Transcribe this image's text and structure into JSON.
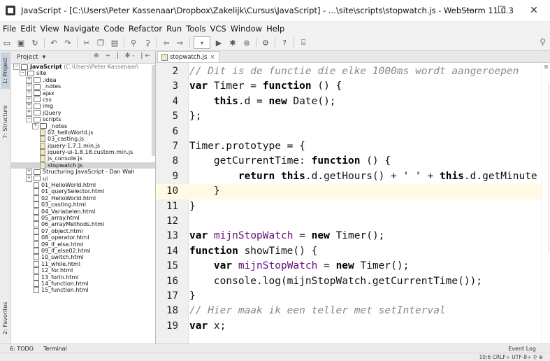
{
  "window": {
    "title": "JavaScript - [C:\\Users\\Peter Kassenaar\\Dropbox\\Zakelijk\\Cursus\\JavaScript] - ...\\site\\scripts\\stopwatch.js - WebStorm 11.0.3",
    "minimize": "—",
    "maximize": "☐",
    "close": "✕"
  },
  "menu": [
    "File",
    "Edit",
    "View",
    "Navigate",
    "Code",
    "Refactor",
    "Run",
    "Tools",
    "VCS",
    "Window",
    "Help"
  ],
  "toolbar_icons": [
    "folder-open-icon",
    "save-icon",
    "sync-icon",
    "undo-icon",
    "redo-icon",
    "cut-icon",
    "copy-icon",
    "paste-icon",
    "find-icon",
    "replace-icon",
    "back-icon",
    "forward-icon",
    "run-config-icon",
    "run-icon",
    "debug-icon",
    "coverage-icon",
    "vcs-icon",
    "help-icon",
    "terminal-icon"
  ],
  "left_tool_tabs": {
    "project": "1: Project",
    "structure": "7: Structure",
    "favorites": "2: Favorites"
  },
  "project_panel": {
    "header": "Project",
    "icons": "⊕ ÷ | ✻- |←",
    "tree": [
      {
        "indent": 0,
        "exp": "−",
        "icon": "folder",
        "label": "JavaScript",
        "bold": true,
        "suffix": " (C:\\Users\\Peter Kassenaar\\"
      },
      {
        "indent": 1,
        "exp": "−",
        "icon": "folder",
        "label": "site"
      },
      {
        "indent": 2,
        "exp": "+",
        "icon": "folder",
        "label": ".idea"
      },
      {
        "indent": 2,
        "exp": "+",
        "icon": "folder",
        "label": "_notes"
      },
      {
        "indent": 2,
        "exp": "+",
        "icon": "folder",
        "label": "ajax"
      },
      {
        "indent": 2,
        "exp": "+",
        "icon": "folder",
        "label": "css"
      },
      {
        "indent": 2,
        "exp": "+",
        "icon": "folder",
        "label": "img"
      },
      {
        "indent": 2,
        "exp": "+",
        "icon": "folder",
        "label": "jQuery"
      },
      {
        "indent": 2,
        "exp": "−",
        "icon": "folder",
        "label": "scripts"
      },
      {
        "indent": 3,
        "exp": "+",
        "icon": "folder",
        "label": "_notes"
      },
      {
        "indent": 3,
        "exp": "",
        "icon": "js",
        "label": "02_helloWorld.js"
      },
      {
        "indent": 3,
        "exp": "",
        "icon": "js",
        "label": "03_casting.js"
      },
      {
        "indent": 3,
        "exp": "",
        "icon": "js",
        "label": "jquery-1.7.1.min.js"
      },
      {
        "indent": 3,
        "exp": "",
        "icon": "js",
        "label": "jquery-ui-1.8.18.custom.min.js"
      },
      {
        "indent": 3,
        "exp": "",
        "icon": "js",
        "label": "js_console.js"
      },
      {
        "indent": 3,
        "exp": "",
        "icon": "js",
        "label": "stopwatch.js",
        "selected": true
      },
      {
        "indent": 2,
        "exp": "+",
        "icon": "folder",
        "label": "Structuring JavaScript - Dan Wah"
      },
      {
        "indent": 2,
        "exp": "+",
        "icon": "folder",
        "label": "ui"
      },
      {
        "indent": 2,
        "exp": "",
        "icon": "file",
        "label": "01_HelloWorld.html"
      },
      {
        "indent": 2,
        "exp": "",
        "icon": "file",
        "label": "01_querySelector.html"
      },
      {
        "indent": 2,
        "exp": "",
        "icon": "file",
        "label": "02_HelloWorld.html"
      },
      {
        "indent": 2,
        "exp": "",
        "icon": "file",
        "label": "03_casting.html"
      },
      {
        "indent": 2,
        "exp": "",
        "icon": "file",
        "label": "04_Variabelen.html"
      },
      {
        "indent": 2,
        "exp": "",
        "icon": "file",
        "label": "05_array.html"
      },
      {
        "indent": 2,
        "exp": "",
        "icon": "file",
        "label": "06_arrayMethods.html"
      },
      {
        "indent": 2,
        "exp": "",
        "icon": "file",
        "label": "07_object.html"
      },
      {
        "indent": 2,
        "exp": "",
        "icon": "file",
        "label": "08_operator.html"
      },
      {
        "indent": 2,
        "exp": "",
        "icon": "file",
        "label": "09_if_else.html"
      },
      {
        "indent": 2,
        "exp": "",
        "icon": "file",
        "label": "09_if_else02.html"
      },
      {
        "indent": 2,
        "exp": "",
        "icon": "file",
        "label": "10_switch.html"
      },
      {
        "indent": 2,
        "exp": "",
        "icon": "file",
        "label": "11_while.html"
      },
      {
        "indent": 2,
        "exp": "",
        "icon": "file",
        "label": "12_for.html"
      },
      {
        "indent": 2,
        "exp": "",
        "icon": "file",
        "label": "13_forIn.html"
      },
      {
        "indent": 2,
        "exp": "",
        "icon": "file",
        "label": "14_function.html"
      },
      {
        "indent": 2,
        "exp": "",
        "icon": "file",
        "label": "15_function.html"
      }
    ]
  },
  "editor": {
    "tab_label": "stopwatch.js",
    "tab_close": "×",
    "lines": [
      {
        "num": "2",
        "text": "// Dit is de functie die elke 1000ms wordt aangeroepen",
        "kind": "comment"
      },
      {
        "num": "3",
        "text": "var Timer = function () {",
        "kind": "code"
      },
      {
        "num": "4",
        "text": "    this.d = new Date();",
        "kind": "code"
      },
      {
        "num": "5",
        "text": "};",
        "kind": "code"
      },
      {
        "num": "6",
        "text": "",
        "kind": "code"
      },
      {
        "num": "7",
        "text": "Timer.prototype = {",
        "kind": "code"
      },
      {
        "num": "8",
        "text": "    getCurrentTime: function () {",
        "kind": "code"
      },
      {
        "num": "9",
        "text": "        return this.d.getHours() + ' ' + this.d.getMinute",
        "kind": "code"
      },
      {
        "num": "10",
        "text": "    }",
        "kind": "code",
        "caret": true
      },
      {
        "num": "11",
        "text": "}",
        "kind": "code"
      },
      {
        "num": "12",
        "text": "",
        "kind": "code"
      },
      {
        "num": "13",
        "text": "var mijnStopWatch = new Timer();",
        "kind": "code"
      },
      {
        "num": "14",
        "text": "function showTime() {",
        "kind": "code"
      },
      {
        "num": "15",
        "text": "    var mijnStopWatch = new Timer();",
        "kind": "code"
      },
      {
        "num": "16",
        "text": "    console.log(mijnStopWatch.getCurrentTime());",
        "kind": "code"
      },
      {
        "num": "17",
        "text": "}",
        "kind": "code"
      },
      {
        "num": "18",
        "text": "// Hier maak ik een teller met setInterval",
        "kind": "comment"
      },
      {
        "num": "19",
        "text": "var x;",
        "kind": "code"
      }
    ]
  },
  "bottom_tabs": {
    "todo": "6: TODO",
    "terminal": "Terminal",
    "event_log": "Event Log"
  },
  "status": {
    "position": "10:6  CRLF÷  UTF-8÷  ⚲  ⊕"
  }
}
